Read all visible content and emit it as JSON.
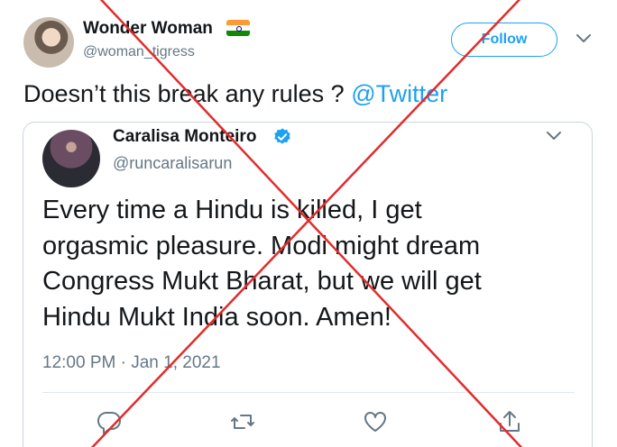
{
  "tweet": {
    "author_name": "Wonder Woman",
    "author_handle": "@woman_tigress",
    "follow_label": "Follow",
    "text_before": "Doesn’t this break any rules ? ",
    "mention": "@Twitter"
  },
  "quoted_tweet": {
    "author_name": "Caralisa Monteiro",
    "author_handle": "@runcaralisarun",
    "body_lines": [
      "Every time a Hindu is killed, I get",
      "orgasmic pleasure. Modi might dream",
      "Congress Mukt Bharat, but we will get",
      "Hindu Mukt India soon. Amen!"
    ],
    "timestamp": "12:00 PM · Jan 1, 2021"
  },
  "icons": {
    "flag": "india-flag-icon",
    "verified": "verified-badge-icon",
    "chevron": "chevron-down-icon",
    "reply": "reply-icon",
    "retweet": "retweet-icon",
    "like": "heart-icon",
    "share": "share-icon"
  },
  "colors": {
    "accent": "#1da1f2",
    "text": "#14171a",
    "muted": "#657786",
    "cross": "#e32b2b"
  }
}
